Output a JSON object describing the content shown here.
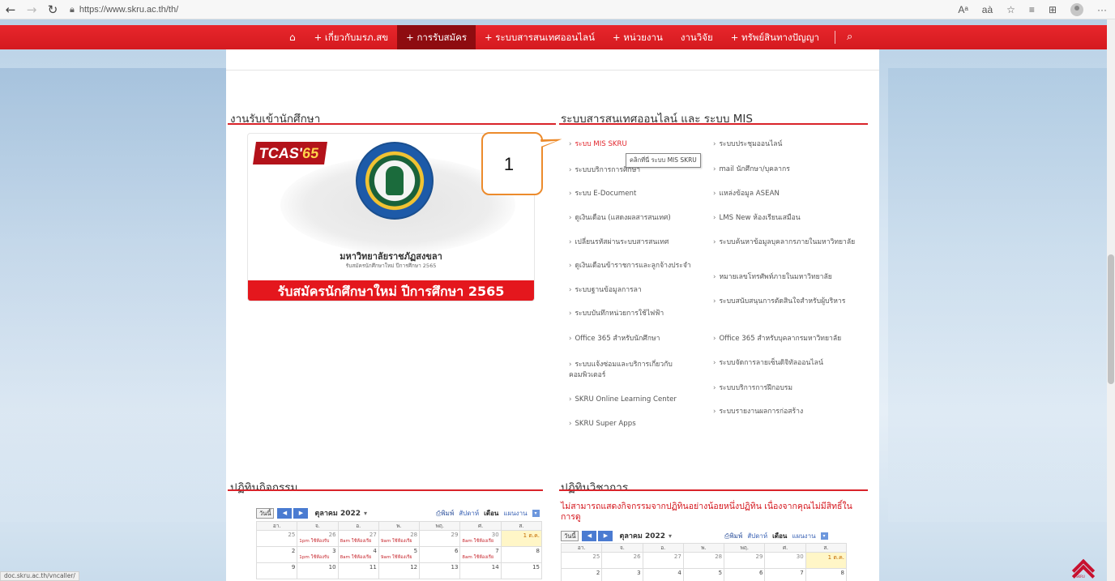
{
  "browser": {
    "url": "https://www.skru.ac.th/th/",
    "status_url": "doc.skru.ac.th/vncaller/",
    "icons": [
      "back-arrow-icon",
      "forward-arrow-icon",
      "refresh-icon",
      "lock-icon",
      "read-aloud-icon",
      "translate-icon",
      "favorite-icon",
      "favorites-list-icon",
      "collections-icon",
      "profile-icon",
      "more-icon"
    ],
    "read_aloud": "Aᵃ",
    "translate": "aà",
    "more": "···"
  },
  "nav": {
    "home": "⌂",
    "items": [
      {
        "label": "+ เกี่ยวกับมรภ.สข",
        "active": false
      },
      {
        "label": "+ การรับสมัคร",
        "active": true
      },
      {
        "label": "+ ระบบสารสนเทศออนไลน์",
        "active": false
      },
      {
        "label": "+ หน่วยงาน",
        "active": false
      },
      {
        "label": "งานวิจัย",
        "active": false
      },
      {
        "label": "+ ทรัพย์สินทางปัญญา",
        "active": false
      }
    ],
    "search": "⌕"
  },
  "sections": {
    "admission": "งานรับเข้านักศึกษา",
    "systems": "ระบบสารสนเทศออนไลน์ และ ระบบ MIS",
    "activities": "ปฏิทินกิจกรรม",
    "academic": "ปฏิทินวิชาการ"
  },
  "banner": {
    "tcas": "TCAS'",
    "tcas_year": "65",
    "university": "มหาวิทยาลัยราชภัฏสงขลา",
    "sub": "รับสมัครนักศึกษาใหม่ ปีการศึกษา 2565",
    "ribbon": "รับสมัครนักศึกษาใหม่  ปีการศึกษา 2565"
  },
  "links_left": [
    "ระบบ MIS SKRU",
    "ระบบบริการการศึกษา",
    "ระบบ E-Document",
    "ดูเงินเดือน (แสดงผลสารสนเทศ)",
    "เปลี่ยนรหัสผ่านระบบสารสนเทศ",
    "ดูเงินเดือนข้าราชการและลูกจ้างประจำ",
    "ระบบฐานข้อมูลการลา",
    "ระบบบันทึกหน่วยการใช้ไฟฟ้า",
    "Office 365 สำหรับนักศึกษา",
    "ระบบแจ้งซ่อมและบริการเกี่ยวกับคอมพิวเตอร์",
    "SKRU Online Learning Center",
    "SKRU Super Apps"
  ],
  "links_right": [
    "ระบบประชุมออนไลน์",
    "mail นักศึกษา/บุคลากร",
    "แหล่งข้อมูล ASEAN",
    "LMS New ห้องเรียนเสมือน",
    "ระบบค้นหาข้อมูลบุคลากรภายในมหาวิทยาลัย",
    "หมายเลขโทรศัพท์ภายในมหาวิทยาลัย",
    "ระบบสนับสนุนการตัดสินใจสำหรับผู้บริหาร",
    "Office 365 สำหรับบุคลากรมหาวิทยาลัย",
    "ระบบจัดการลายเซ็นดิจิทัลออนไลน์",
    "ระบบบริการการฝึกอบรม",
    "ระบบรายงานผลการก่อสร้าง"
  ],
  "tooltip": "คลิกที่นี่ ระบบ MIS SKRU",
  "callout": "1",
  "calendar": {
    "today_btn": "วันนี้",
    "month": "ตุลาคม 2022",
    "dropdown": "▾",
    "print": "พิมพ์",
    "views": [
      "สัปดาห์",
      "เดือน",
      "แผนงาน"
    ],
    "weekdays": [
      "อา.",
      "จ.",
      "อ.",
      "พ.",
      "พฤ.",
      "ศ.",
      "ส."
    ],
    "week1": [
      "25",
      "26",
      "27",
      "28",
      "29",
      "30",
      "1 ต.ค."
    ],
    "week2": [
      "2",
      "3",
      "4",
      "5",
      "6",
      "7",
      "8"
    ],
    "week3": [
      "9",
      "10",
      "11",
      "12",
      "13",
      "14",
      "15"
    ],
    "ev1": "1pm ใช้ห้องรับ",
    "ev2": "8am ใช้ห้องเรีย",
    "ev3": "9am ใช้ห้องเรีย",
    "ev4": "8am ใช้ห้องเรีย",
    "error": "ไม่สามารถแสดงกิจกรรมจากปฏิทินอย่างน้อยหนึ่งปฏิทิน เนื่องจากคุณไม่มีสิทธิ์ในการดู"
  },
  "totop_logo": "SKRU"
}
